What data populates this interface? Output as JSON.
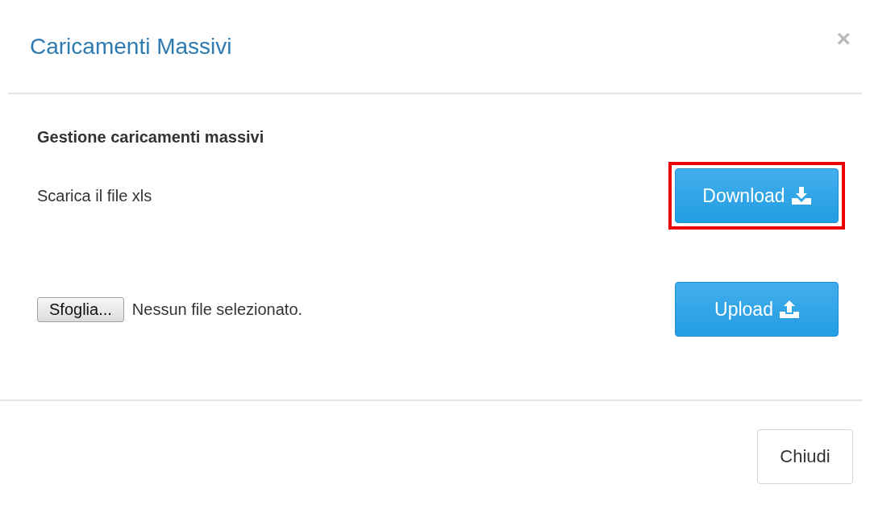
{
  "modal": {
    "title": "Caricamenti Massivi",
    "close": "×",
    "section_title": "Gestione caricamenti massivi",
    "rows": [
      {
        "kind": "download",
        "label": "Scarica il file xls",
        "button": "Download",
        "highlighted": true
      },
      {
        "kind": "upload",
        "file_button": "Sfoglia...",
        "file_status": "Nessun file selezionato.",
        "button": "Upload",
        "highlighted": false
      }
    ],
    "footer_button": "Chiudi"
  }
}
